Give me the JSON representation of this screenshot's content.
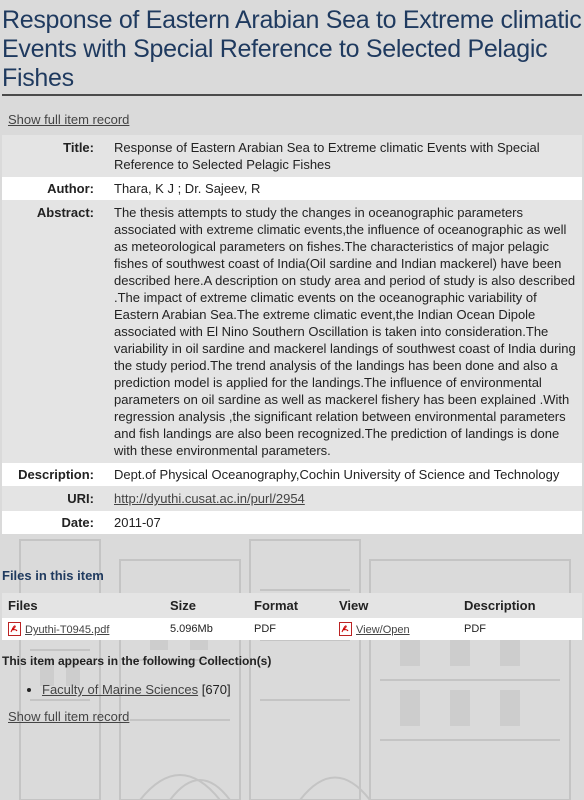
{
  "item": {
    "title": "Response of Eastern Arabian Sea to Extreme climatic Events with Special Reference to Selected Pelagic Fishes",
    "show_full_record_label": "Show full item record",
    "fields": {
      "title_label": "Title:",
      "title_value": "Response of Eastern Arabian Sea to Extreme climatic Events with Special Reference to Selected Pelagic Fishes",
      "author_label": "Author:",
      "author_value": "Thara, K J ; Dr. Sajeev, R",
      "abstract_label": "Abstract:",
      "abstract_value": "The thesis attempts to study the changes in oceanographic parameters associated with extreme climatic events,the influence of oceanographic as well as meteorological parameters on fishes.The characteristics of major pelagic fishes of southwest coast of India(Oil sardine and Indian mackerel) have been described here.A description on study area and period of study is also described .The impact of extreme climatic events on the oceanographic variability of Eastern Arabian Sea.The extreme climatic event,the Indian Ocean Dipole associated with El Nino Southern Oscillation is taken into consideration.The variability in oil sardine and mackerel landings of southwest coast of India during the study period.The trend analysis of the landings has been done and also a prediction model is applied for the landings.The influence of environmental parameters on oil sardine as well as mackerel fishery has been explained .With regression analysis ,the significant relation between environmental parameters and fish landings are also been recognized.The prediction of landings is done with these environmental parameters.",
      "description_label": "Description:",
      "description_value": "Dept.of Physical Oceanography,Cochin University of Science and Technology",
      "uri_label": "URI:",
      "uri_value": "http://dyuthi.cusat.ac.in/purl/2954",
      "date_label": "Date:",
      "date_value": "2011-07"
    }
  },
  "files_section": {
    "heading": "Files in this item",
    "columns": [
      "Files",
      "Size",
      "Format",
      "View",
      "Description"
    ],
    "rows": [
      {
        "file_name": "Dyuthi-T0945.pdf",
        "size": "5.096Mb",
        "format": "PDF",
        "view_label": "View/Open",
        "description": "PDF",
        "icon": "pdf-icon"
      }
    ]
  },
  "collections": {
    "heading": "This item appears in the following Collection(s)",
    "items": [
      {
        "name": "Faculty of Marine Sciences",
        "count": "[670]"
      }
    ]
  },
  "colors": {
    "title": "#1f3a5f",
    "row_odd": "#e4e4e4",
    "row_even": "#ffffff",
    "background": "#d9d9d9"
  }
}
